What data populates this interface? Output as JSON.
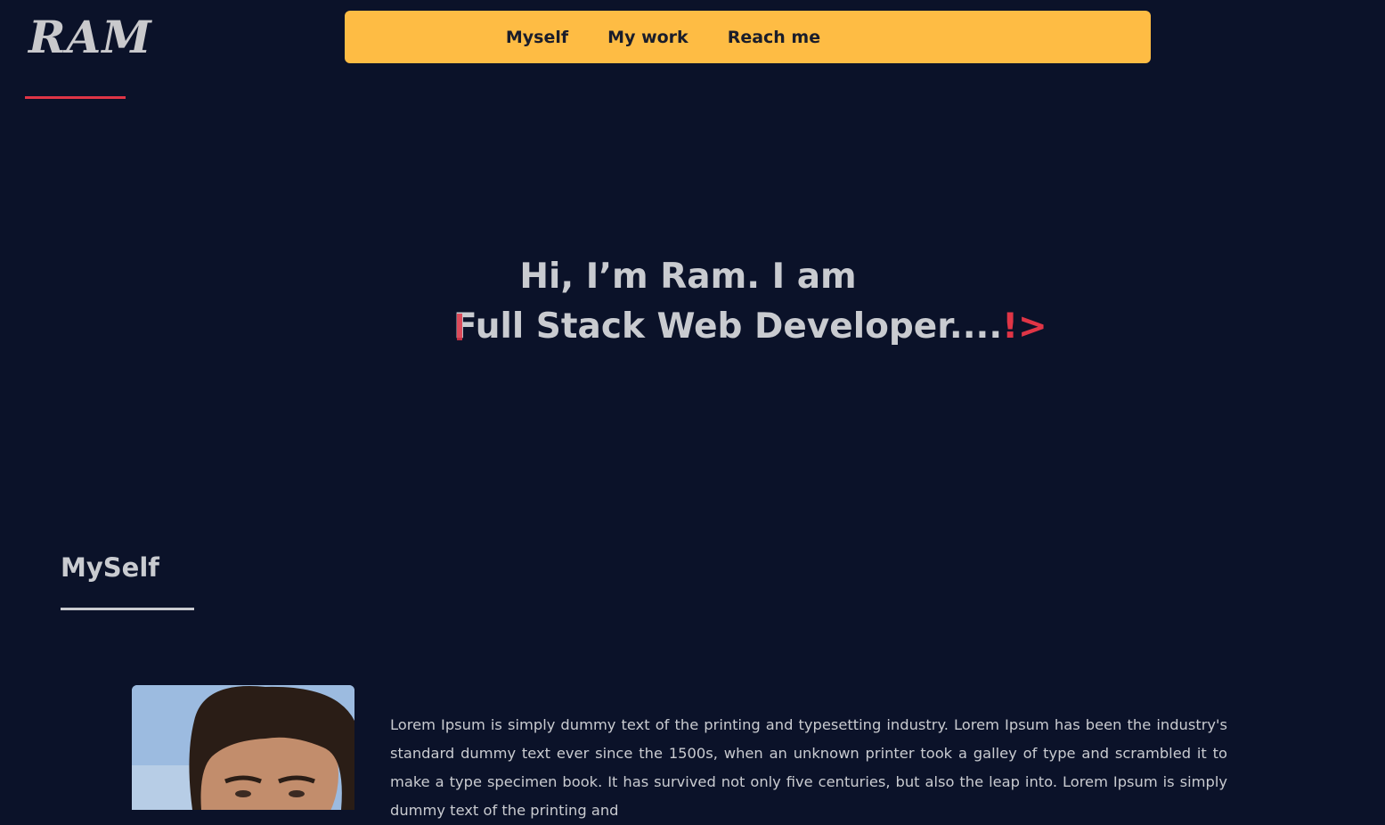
{
  "brand": {
    "logo_text": "RAM"
  },
  "nav": {
    "items": [
      {
        "label": "Myself"
      },
      {
        "label": "My work"
      },
      {
        "label": "Reach me"
      }
    ]
  },
  "hero": {
    "line1": "Hi, I’m Ram. I am",
    "line2": "Full Stack Web Developer....",
    "cursor": "!>"
  },
  "about": {
    "title": "MySelf",
    "photo_icon": "profile-photo",
    "paragraph": "Lorem Ipsum is simply dummy text of the printing and typesetting industry. Lorem Ipsum has been the industry's standard dummy text ever since the 1500s, when an unknown printer took a galley of type and scrambled it to make a type specimen book. It has survived not only five centuries, but also the leap into. Lorem Ipsum is simply dummy text of the printing and"
  },
  "colors": {
    "background": "#0b1229",
    "nav_background": "#febc44",
    "accent": "#e03546",
    "text": "#c9cbd0"
  }
}
